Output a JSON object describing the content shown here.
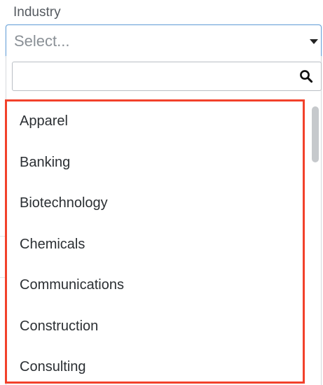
{
  "field": {
    "label": "Industry",
    "placeholder": "Select..."
  },
  "search": {
    "value": "",
    "placeholder": "",
    "icon": "search-icon"
  },
  "options": [
    "Apparel",
    "Banking",
    "Biotechnology",
    "Chemicals",
    "Communications",
    "Construction",
    "Consulting"
  ],
  "colors": {
    "focus_border": "#6aa2d8",
    "highlight_border": "#f2412b",
    "text": "#2b2f33",
    "placeholder": "#8a9096"
  }
}
